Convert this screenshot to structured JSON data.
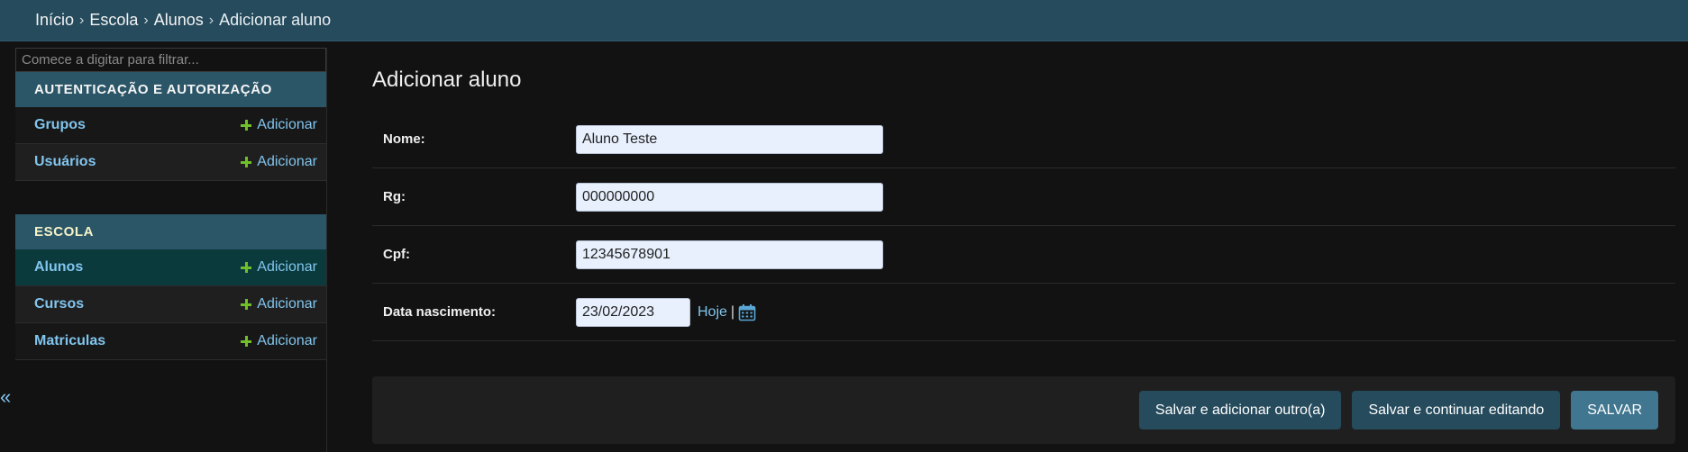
{
  "breadcrumb": {
    "items": [
      "Início",
      "Escola",
      "Alunos"
    ],
    "current": "Adicionar aluno",
    "separator": "›"
  },
  "sidebar": {
    "filter_placeholder": "Comece a digitar para filtrar...",
    "add_label": "Adicionar",
    "modules": [
      {
        "title": "AUTENTICAÇÃO E AUTORIZAÇÃO",
        "items": [
          "Grupos",
          "Usuários"
        ]
      },
      {
        "title": "ESCOLA",
        "items": [
          "Alunos",
          "Cursos",
          "Matriculas"
        ]
      }
    ],
    "collapse_icon": "«"
  },
  "main": {
    "title": "Adicionar aluno",
    "fields": {
      "nome": {
        "label": "Nome:",
        "value": "Aluno Teste"
      },
      "rg": {
        "label": "Rg:",
        "value": "000000000"
      },
      "cpf": {
        "label": "Cpf:",
        "value": "12345678901"
      },
      "data_nascimento": {
        "label": "Data nascimento:",
        "value": "23/02/2023",
        "today_label": "Hoje",
        "separator": "|"
      }
    },
    "buttons": {
      "save_add_another": "Salvar e adicionar outro(a)",
      "save_continue": "Salvar e continuar editando",
      "save": "SALVAR"
    }
  },
  "colors": {
    "header": "#264b5d",
    "link": "#81c5ee",
    "add_icon": "#70bf2b",
    "active_row": "#0b3a3d"
  }
}
